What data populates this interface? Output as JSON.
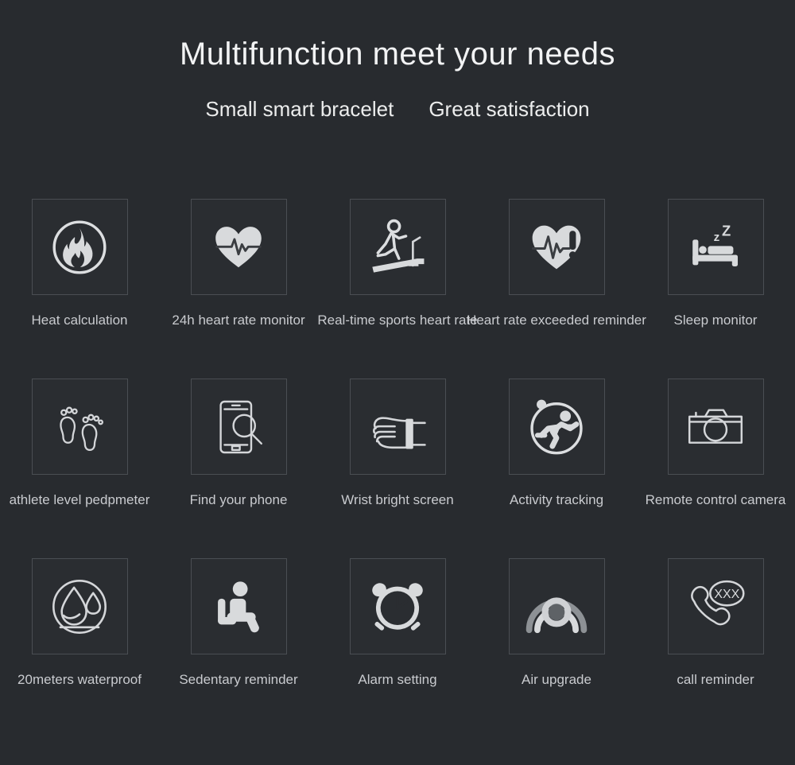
{
  "headline": "Multifunction meet your needs",
  "subheadline": {
    "left": "Small smart bracelet",
    "right": "Great satisfaction"
  },
  "colors": {
    "background": "#282b2f",
    "tile_border": "#4a4e53",
    "icon": "#d8dadc",
    "caption_text": "#c9cbcf",
    "headline_text": "#f2f3f4"
  },
  "features": [
    [
      {
        "label": "Heat calculation",
        "icon": "flame-circle-icon"
      },
      {
        "label": "24h heart rate monitor",
        "icon": "heart-pulse-icon"
      },
      {
        "label": "Real-time sports heart rate",
        "icon": "treadmill-runner-icon"
      },
      {
        "label": "Heart rate exceeded reminder",
        "icon": "heart-alert-icon"
      },
      {
        "label": "Sleep monitor",
        "icon": "bed-sleep-icon"
      }
    ],
    [
      {
        "label": "athlete level pedpmeter",
        "icon": "footprints-icon"
      },
      {
        "label": "Find your phone",
        "icon": "phone-search-icon"
      },
      {
        "label": "Wrist bright screen",
        "icon": "wrist-raise-icon"
      },
      {
        "label": "Activity tracking",
        "icon": "runner-circle-icon"
      },
      {
        "label": "Remote control camera",
        "icon": "camera-icon"
      }
    ],
    [
      {
        "label": "20meters waterproof",
        "icon": "water-drop-circle-icon"
      },
      {
        "label": "Sedentary reminder",
        "icon": "seated-person-icon"
      },
      {
        "label": "Alarm setting",
        "icon": "alarm-clock-icon"
      },
      {
        "label": "Air upgrade",
        "icon": "wireless-waves-icon"
      },
      {
        "label": "call reminder",
        "icon": "phone-call-bubble-icon"
      }
    ]
  ]
}
